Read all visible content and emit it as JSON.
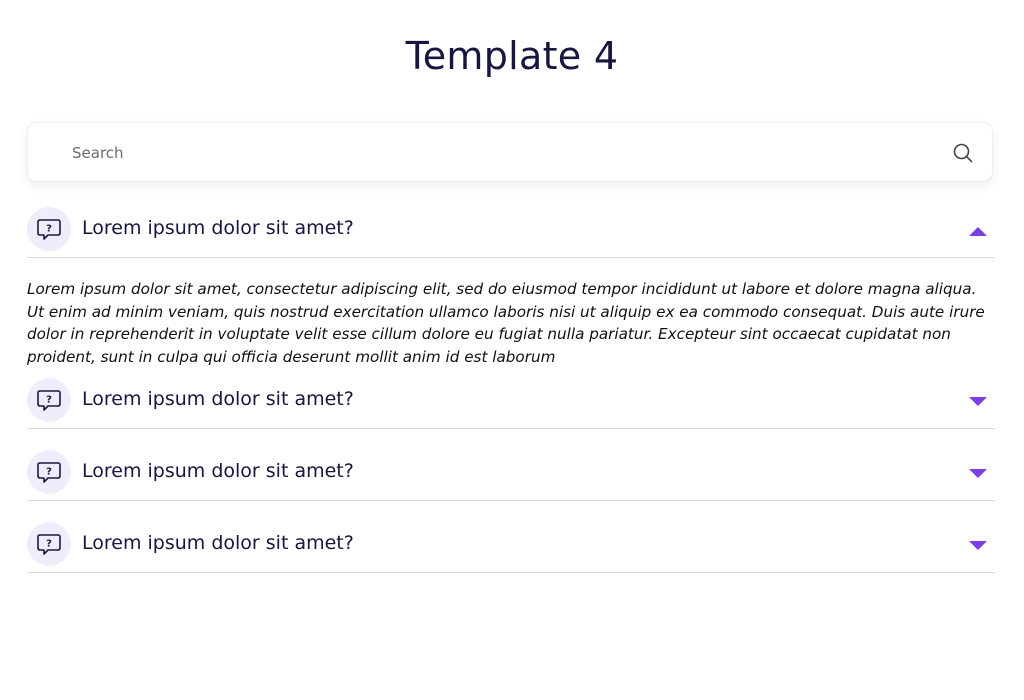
{
  "page": {
    "title": "Template 4"
  },
  "search": {
    "placeholder": "Search",
    "value": "",
    "icon": "search-icon"
  },
  "faq": {
    "items": [
      {
        "question": "Lorem ipsum dolor sit amet?",
        "expanded": true,
        "answer": "Lorem ipsum dolor sit amet, consectetur adipiscing elit, sed do eiusmod tempor incididunt ut labore et dolore magna aliqua. Ut enim ad minim veniam, quis nostrud exercitation ullamco laboris nisi ut aliquip ex ea commodo consequat. Duis aute irure dolor in reprehenderit in voluptate velit esse cillum dolore eu fugiat nulla pariatur. Excepteur sint occaecat cupidatat non proident, sunt in culpa qui officia deserunt mollit anim id est laborum"
      },
      {
        "question": "Lorem ipsum dolor sit amet?",
        "expanded": false
      },
      {
        "question": "Lorem ipsum dolor sit amet?",
        "expanded": false
      },
      {
        "question": "Lorem ipsum dolor sit amet?",
        "expanded": false
      }
    ]
  },
  "colors": {
    "accent": "#7b3fe4",
    "badge_bg": "#f1ecfb",
    "title": "#16163f",
    "divider": "#d8d8dc"
  },
  "icons": {
    "question": "question-bubble-icon",
    "expanded": "chevron-up-icon",
    "collapsed": "chevron-down-icon"
  }
}
